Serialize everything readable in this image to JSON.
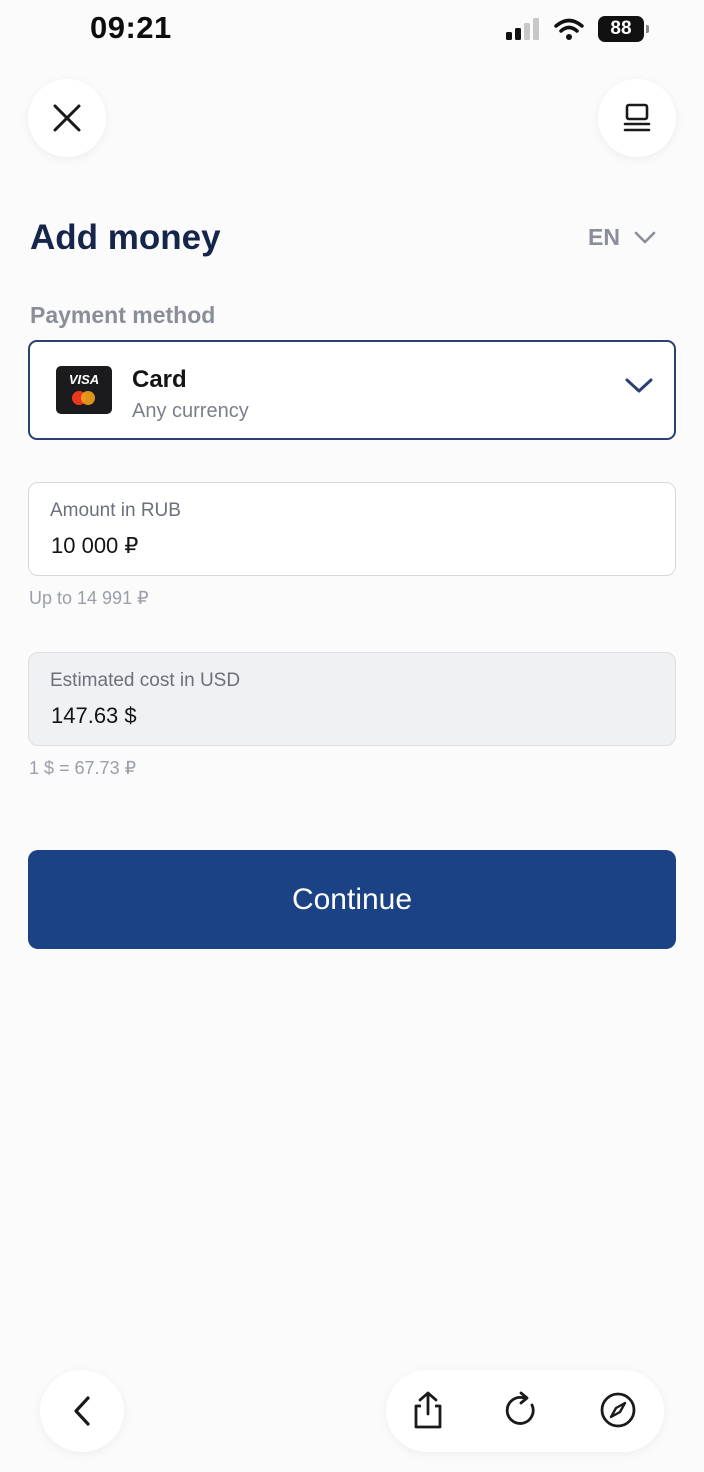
{
  "status_bar": {
    "time": "09:21",
    "battery": "88",
    "icons": [
      "cellular-signal-icon",
      "wifi-icon",
      "battery-icon"
    ]
  },
  "header": {
    "close_icon": "close-icon",
    "menu_icon": "menu-icon"
  },
  "page": {
    "title": "Add money",
    "language": "EN"
  },
  "payment": {
    "section_label": "Payment method",
    "method_title": "Card",
    "method_subtitle": "Any currency",
    "card_logo_text": "VISA"
  },
  "amount": {
    "label": "Amount in RUB",
    "value": "10 000 ₽",
    "hint": "Up to 14 991 ₽"
  },
  "estimate": {
    "label": "Estimated cost in USD",
    "value": "147.63 $",
    "rate": "1 $ = 67.73 ₽"
  },
  "actions": {
    "continue_label": "Continue"
  },
  "browser_toolbar": {
    "icons": [
      "back-icon",
      "share-icon",
      "reload-icon",
      "compass-icon"
    ]
  },
  "colors": {
    "primary": "#1c4286",
    "title": "#16254a",
    "muted": "#8a8e98"
  }
}
